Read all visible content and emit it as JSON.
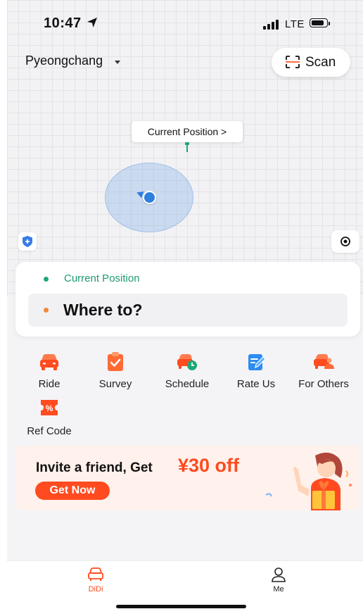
{
  "status_bar": {
    "time": "10:47",
    "network": "LTE"
  },
  "header": {
    "city": "Pyeongchang",
    "scan_label": "Scan"
  },
  "map": {
    "position_bubble": "Current Position >"
  },
  "trip": {
    "current_label": "Current Position",
    "destination_placeholder": "Where to?"
  },
  "services": [
    {
      "label": "Ride",
      "icon": "car-icon"
    },
    {
      "label": "Survey",
      "icon": "clipboard-check-icon"
    },
    {
      "label": "Schedule",
      "icon": "car-clock-icon"
    },
    {
      "label": "Rate Us",
      "icon": "pencil-note-icon"
    },
    {
      "label": "For Others",
      "icon": "car-person-icon"
    },
    {
      "label": "Ref Code",
      "icon": "percent-ticket-icon"
    }
  ],
  "banner": {
    "text": "Invite a friend, Get",
    "amount": "¥30 off",
    "button": "Get Now"
  },
  "tabbar": {
    "items": [
      {
        "label": "DiDi",
        "active": true
      },
      {
        "label": "Me",
        "active": false
      }
    ]
  },
  "colors": {
    "accent": "#ff4b1f",
    "green": "#1fa777",
    "orange": "#f08a3c",
    "blue": "#2d7fe0"
  }
}
